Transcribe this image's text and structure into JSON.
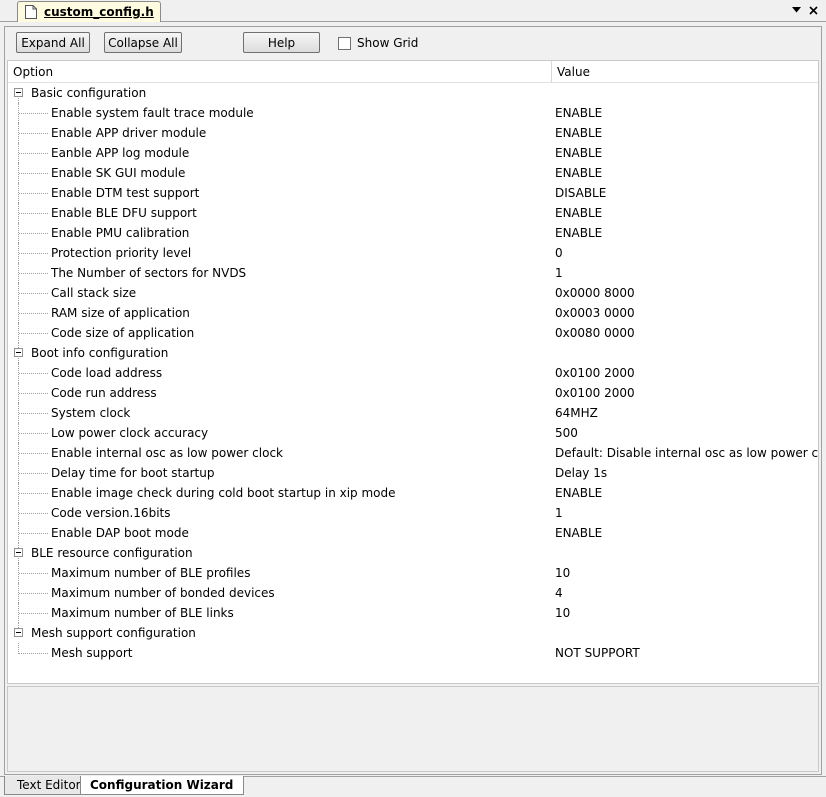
{
  "file_tab": {
    "label": "custom_config.h",
    "icon": "document-icon"
  },
  "toolbar": {
    "expand_all": "Expand All",
    "collapse_all": "Collapse All",
    "help": "Help",
    "show_grid": "Show Grid",
    "show_grid_checked": false
  },
  "columns": {
    "option": "Option",
    "value": "Value"
  },
  "groups": [
    {
      "label": "Basic configuration",
      "items": [
        {
          "label": "Enable system fault trace module",
          "value": "ENABLE"
        },
        {
          "label": "Enable APP driver module",
          "value": "ENABLE"
        },
        {
          "label": "Eanble APP log module",
          "value": "ENABLE"
        },
        {
          "label": "Enable SK GUI module",
          "value": "ENABLE"
        },
        {
          "label": "Enable DTM test support",
          "value": "DISABLE"
        },
        {
          "label": "Enable BLE DFU support",
          "value": "ENABLE"
        },
        {
          "label": "Enable PMU calibration",
          "value": "ENABLE"
        },
        {
          "label": "Protection priority level",
          "value": "0"
        },
        {
          "label": "The Number of sectors for NVDS",
          "value": "1"
        },
        {
          "label": "Call stack size",
          "value": "0x0000 8000"
        },
        {
          "label": "RAM size of application",
          "value": "0x0003 0000"
        },
        {
          "label": "Code size of application",
          "value": "0x0080 0000"
        }
      ]
    },
    {
      "label": "Boot info configuration",
      "items": [
        {
          "label": "Code load address",
          "value": "0x0100 2000"
        },
        {
          "label": "Code run address",
          "value": "0x0100 2000"
        },
        {
          "label": "System clock",
          "value": "64MHZ"
        },
        {
          "label": "Low power clock accuracy",
          "value": "500"
        },
        {
          "label": "Enable internal osc as low power clock",
          "value": "Default: Disable internal osc as low power clock"
        },
        {
          "label": "Delay time for boot startup",
          "value": "Delay 1s"
        },
        {
          "label": "Enable image check during cold boot startup in xip mode",
          "value": "ENABLE"
        },
        {
          "label": "Code version.16bits",
          "value": "1"
        },
        {
          "label": "Enable DAP boot mode",
          "value": "ENABLE"
        }
      ]
    },
    {
      "label": "BLE resource configuration",
      "items": [
        {
          "label": "Maximum number of BLE profiles",
          "value": "10"
        },
        {
          "label": "Maximum number of bonded devices",
          "value": "4"
        },
        {
          "label": "Maximum number of BLE links",
          "value": "10"
        }
      ]
    },
    {
      "label": "Mesh support configuration",
      "items": [
        {
          "label": "Mesh support",
          "value": "NOT SUPPORT"
        }
      ]
    }
  ],
  "bottom_tabs": [
    {
      "label": "Text Editor",
      "active": false
    },
    {
      "label": "Configuration Wizard",
      "active": true
    }
  ],
  "colors": {
    "file_tab_bg": "#fffbe0",
    "active_tab_bg": "#ffffff",
    "panel_bg": "#f0f0f0"
  }
}
